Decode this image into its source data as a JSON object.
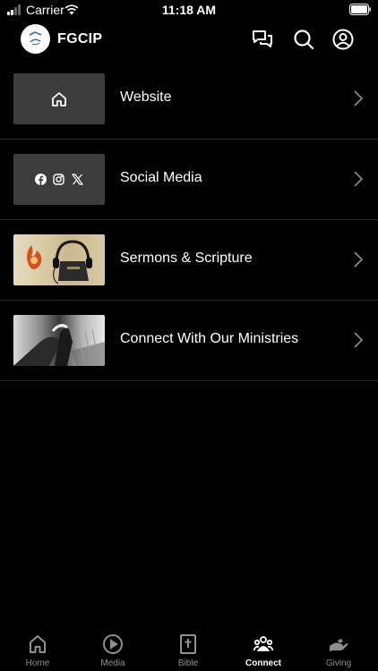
{
  "status_bar": {
    "carrier": "Carrier",
    "time": "11:18 AM"
  },
  "header": {
    "app_title": "FGCIP"
  },
  "list": [
    {
      "label": "Website",
      "icon": "home-icon"
    },
    {
      "label": "Social Media",
      "icons": [
        "facebook-icon",
        "instagram-icon",
        "x-icon"
      ]
    },
    {
      "label": "Sermons & Scripture",
      "thumb": "headphones-bible-image"
    },
    {
      "label": "Connect With Our Ministries",
      "thumb": "clasped-hands-image"
    }
  ],
  "tabbar": {
    "active": "Connect",
    "tabs": [
      {
        "label": "Home",
        "icon": "home-icon"
      },
      {
        "label": "Media",
        "icon": "play-icon"
      },
      {
        "label": "Bible",
        "icon": "bible-icon"
      },
      {
        "label": "Connect",
        "icon": "people-icon"
      },
      {
        "label": "Giving",
        "icon": "giving-hand-icon"
      }
    ]
  },
  "colors": {
    "background": "#000000",
    "text": "#ffffff",
    "inactive_tab": "#8e8e93",
    "thumb_bg": "#3c3c3c"
  }
}
